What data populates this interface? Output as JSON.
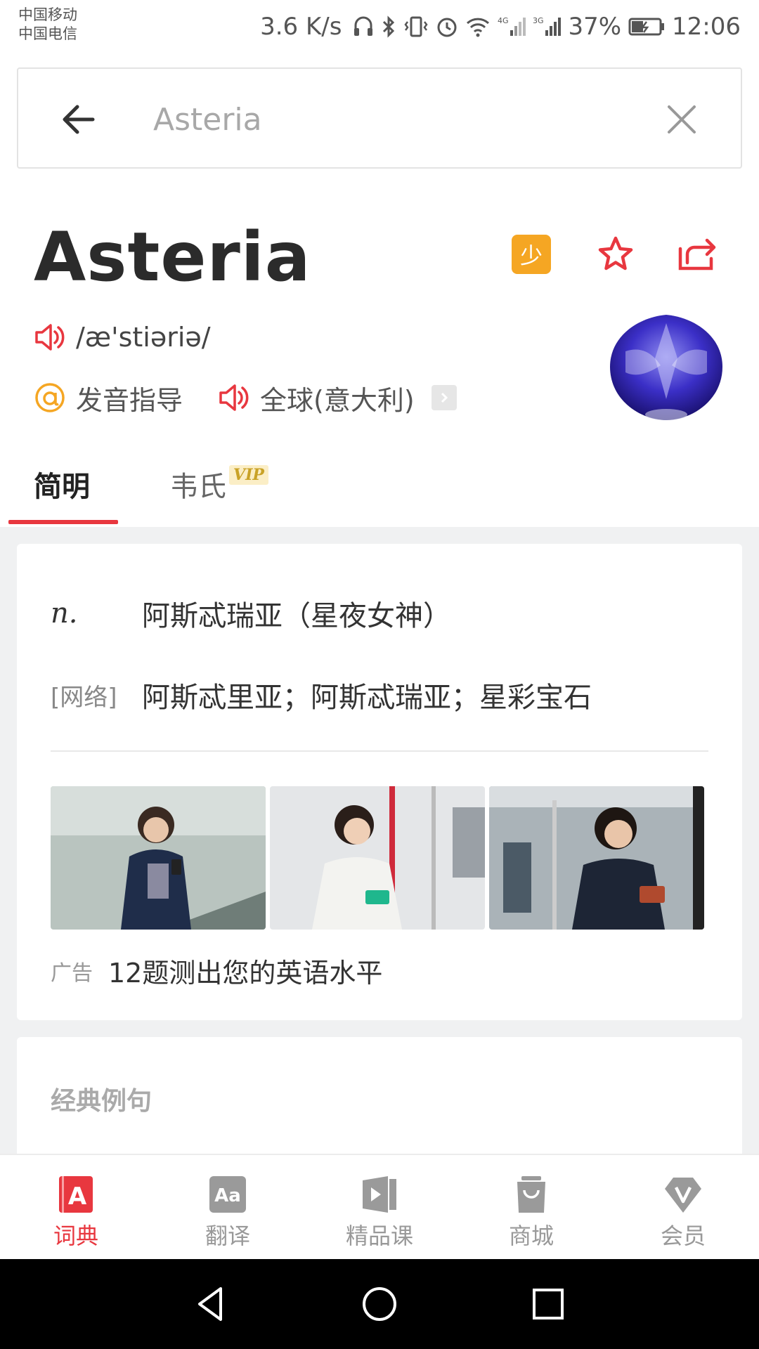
{
  "status_bar": {
    "carrier1": "中国移动",
    "carrier2": "中国电信",
    "net_speed": "3.6 K/s",
    "battery": "37%",
    "time": "12:06"
  },
  "search": {
    "placeholder": "Asteria"
  },
  "word": {
    "title": "Asteria",
    "badge": "少",
    "phonetic": "/æ'stiəriə/",
    "pron_guide": "发音指导",
    "pron_global": "全球(意大利)"
  },
  "tabs": {
    "jianming": "简明",
    "webster": "韦氏",
    "vip": "VIP"
  },
  "definitions": {
    "pos": "n.",
    "meaning": "阿斯忒瑞亚（星夜女神）",
    "net_tag": "[网络]",
    "net_meaning": "阿斯忒里亚；阿斯忒瑞亚；星彩宝石"
  },
  "ad": {
    "tag": "广告",
    "text": "12题测出您的英语水平"
  },
  "examples": {
    "title": "经典例句"
  },
  "bottom_nav": [
    {
      "label": "词典",
      "icon": "dictionary-icon",
      "active": true
    },
    {
      "label": "翻译",
      "icon": "translate-icon",
      "active": false
    },
    {
      "label": "精品课",
      "icon": "course-icon",
      "active": false
    },
    {
      "label": "商城",
      "icon": "shop-icon",
      "active": false
    },
    {
      "label": "会员",
      "icon": "vip-diamond-icon",
      "active": false
    }
  ],
  "colors": {
    "accent": "#e8373f",
    "badge_orange": "#f5a623",
    "vip_gold": "#c9a227"
  }
}
